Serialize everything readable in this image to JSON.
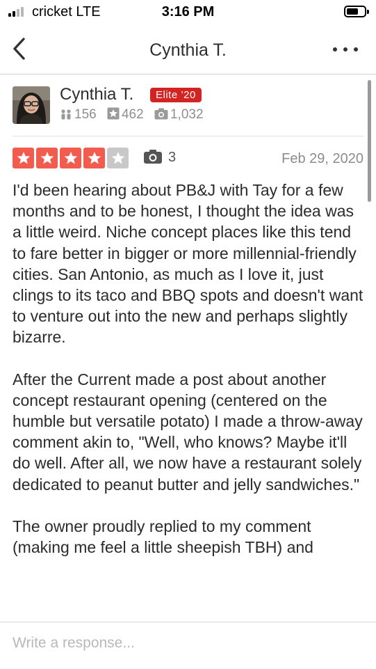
{
  "status_bar": {
    "carrier": "cricket  LTE",
    "time": "3:16 PM"
  },
  "navbar": {
    "title": "Cynthia T.",
    "back_icon": "chevron-left-icon",
    "more_icon": "more-horizontal-icon"
  },
  "user": {
    "name": "Cynthia T.",
    "badge": "Elite ’20",
    "friends": "156",
    "reviews": "462",
    "photos": "1,032"
  },
  "review": {
    "rating": 4,
    "rating_max": 5,
    "photo_count": "3",
    "date": "Feb 29, 2020",
    "paragraphs": [
      "I'd been hearing about PB&J with Tay for a few months and to be honest, I thought the idea was a little weird. Niche concept places like this tend to fare better in bigger or more millennial-friendly cities. San Antonio, as much as I love it, just clings to its taco and BBQ spots and doesn't want to venture out into the new and perhaps slightly bizarre.",
      "After the Current made a post about another concept restaurant opening (centered on the humble but versatile potato) I made a throw-away comment akin to, \"Well, who knows? Maybe it'll do well. After all, we now have a restaurant solely dedicated to peanut butter and jelly sandwiches.\"",
      "The owner proudly replied to my comment (making me feel a little sheepish TBH) and"
    ]
  },
  "response": {
    "placeholder": "Write a response..."
  },
  "colors": {
    "star_active": "#f15c4f",
    "star_inactive": "#c8c8c8",
    "elite_badge": "#d32323"
  }
}
